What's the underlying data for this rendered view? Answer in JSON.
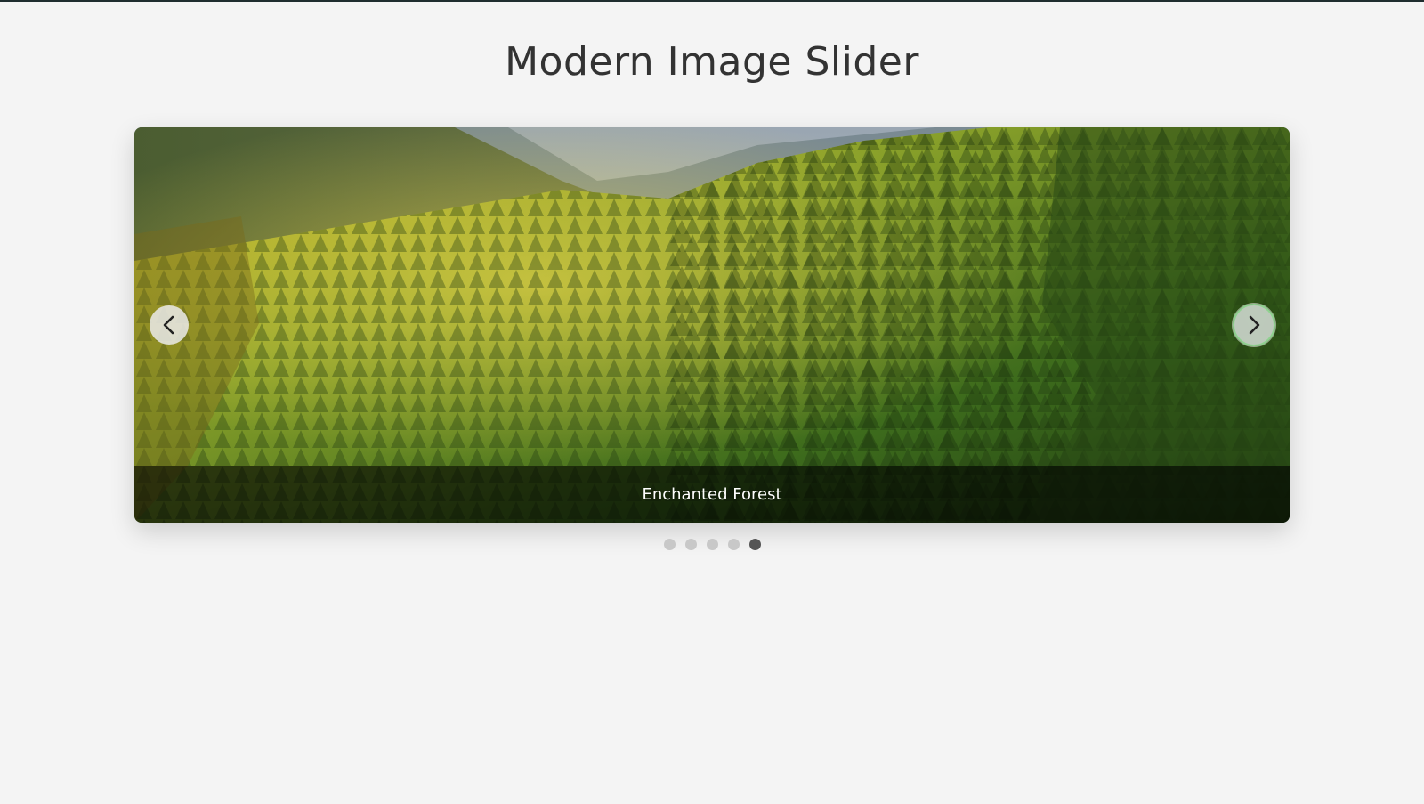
{
  "page": {
    "title": "Modern Image Slider"
  },
  "slider": {
    "caption": "Enchanted Forest",
    "prev_icon": "chevron-left-icon",
    "next_icon": "chevron-right-icon",
    "image_subject": "forest-hillside-photo",
    "total_slides": 5,
    "active_slide": 5
  },
  "colors": {
    "background": "#f4f4f4",
    "title": "#333333",
    "caption_bg": "#000000",
    "dot_inactive": "#c8c8c8",
    "dot_active": "#555555",
    "next_button_outline": "#8fd18f"
  }
}
